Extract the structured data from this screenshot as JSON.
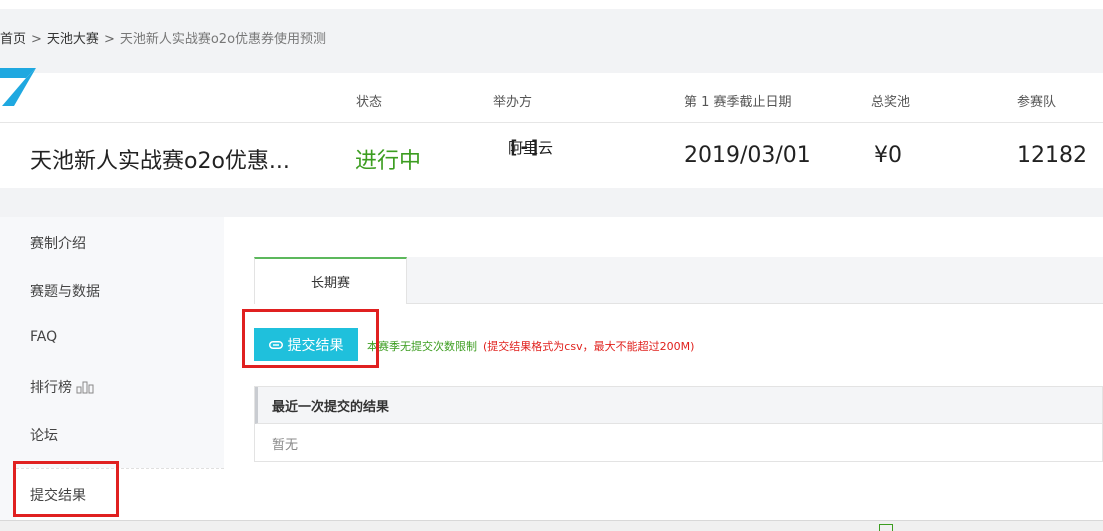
{
  "breadcrumb": {
    "home": "首页",
    "separator": ">",
    "category": "天池大赛",
    "current": "天池新人实战赛o2o优惠券使用预测"
  },
  "info": {
    "headers": {
      "status": "状态",
      "organizer": "举办方",
      "deadline": "第 1 赛季截止日期",
      "prize": "总奖池",
      "teams": "参赛队"
    },
    "title": "天池新人实战赛o2o优惠...",
    "status": "进行中",
    "organizer_logo": {
      "bracket": "[-]",
      "name": "阿里云"
    },
    "deadline": "2019/03/01",
    "prize": "¥0",
    "teams": "12182"
  },
  "sidebar": {
    "items": [
      {
        "label": "赛制介绍"
      },
      {
        "label": "赛题与数据"
      },
      {
        "label": "FAQ"
      },
      {
        "label": "排行榜"
      },
      {
        "label": "论坛"
      },
      {
        "label": "提交结果"
      }
    ]
  },
  "main": {
    "tab_label": "长期赛",
    "submit_button": "提交结果",
    "note_green": "本赛季无提交次数限制",
    "note_red": "(提交结果格式为csv，最大不能超过200M)",
    "result_header": "最近一次提交的结果",
    "result_value": "暂无"
  },
  "colors": {
    "accent": "#1fc0dc",
    "status_green": "#3c9d20",
    "highlight_red": "#e02020"
  },
  "icons": {
    "logo": "tianchi-logo-icon",
    "leaderboard": "bar-chart-icon",
    "submit": "paperclip-icon"
  }
}
